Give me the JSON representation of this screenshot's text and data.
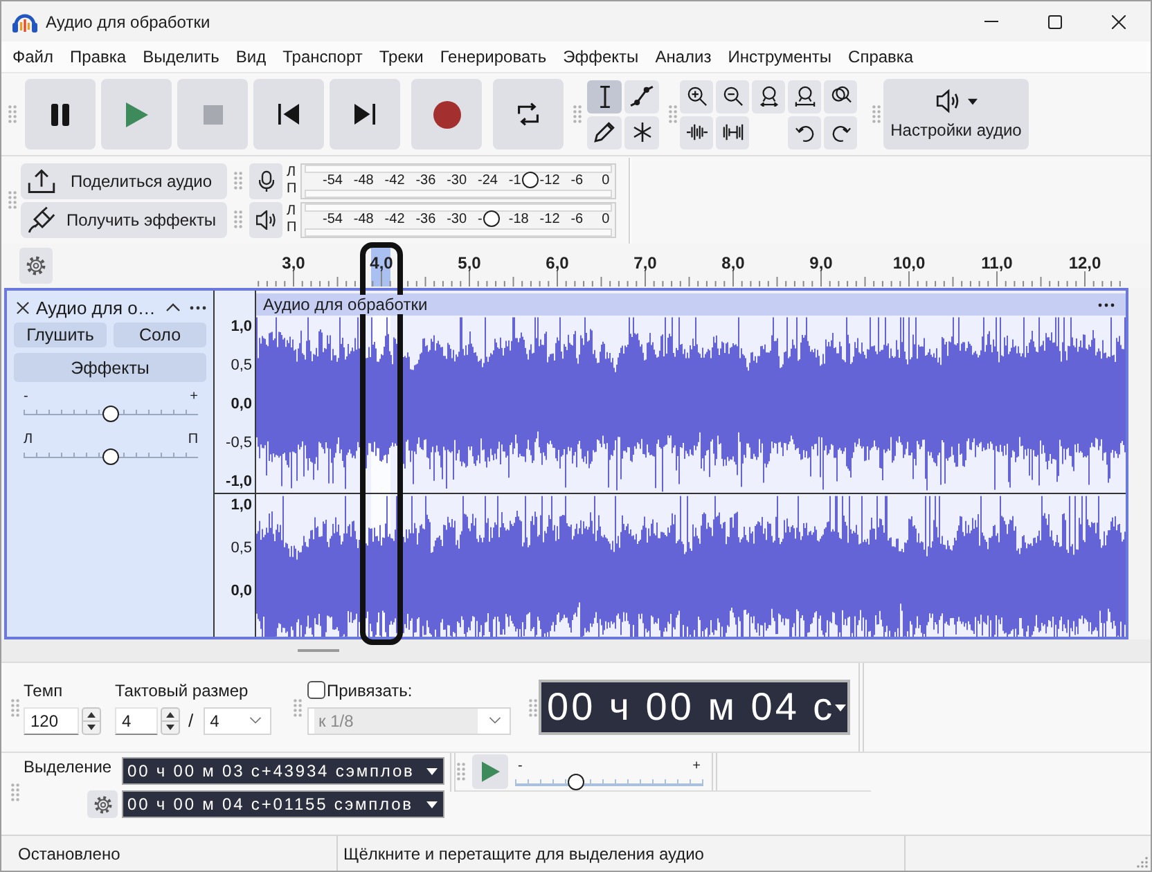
{
  "window": {
    "title": "Аудио для обработки"
  },
  "menu": [
    "Файл",
    "Правка",
    "Выделить",
    "Вид",
    "Транспорт",
    "Треки",
    "Генерировать",
    "Эффекты",
    "Анализ",
    "Инструменты",
    "Справка"
  ],
  "transport": [
    {
      "kind": "pause",
      "disabled": false
    },
    {
      "kind": "play",
      "disabled": false
    },
    {
      "kind": "stop",
      "disabled": true
    },
    {
      "kind": "skip_start",
      "disabled": false
    },
    {
      "kind": "skip_end",
      "disabled": false
    },
    {
      "kind": "record",
      "disabled": false
    },
    {
      "kind": "loop",
      "disabled": false
    }
  ],
  "tools": [
    {
      "kind": "select",
      "selected": true
    },
    {
      "kind": "envelope",
      "selected": false
    },
    {
      "kind": "draw",
      "selected": false
    },
    {
      "kind": "multi",
      "selected": false
    }
  ],
  "audio_setup": {
    "label": "Настройки аудио"
  },
  "share_audio": {
    "label": "Поделиться аудио"
  },
  "get_effects": {
    "label": "Получить эффекты"
  },
  "meters": [
    {
      "kind": "record",
      "channels": [
        "Л",
        "П"
      ],
      "ticks": [
        "-54",
        "-48",
        "-42",
        "-36",
        "-30",
        "-24",
        "-1",
        "-12",
        "-6",
        "0"
      ],
      "level": 0.73
    },
    {
      "kind": "playback",
      "channels": [
        "Л",
        "П"
      ],
      "ticks": [
        "-54",
        "-48",
        "-42",
        "-36",
        "-30",
        "-",
        "-18",
        "-12",
        "-6",
        "0"
      ],
      "level": 0.605
    }
  ],
  "ruler": {
    "ticks": [
      "3,0",
      "4,0",
      "5,0",
      "6,0",
      "7,0",
      "8,0",
      "9,0",
      "10,0",
      "11,0",
      "12,0"
    ]
  },
  "track": {
    "name": "Аудио для о…",
    "mute": "Глушить",
    "solo": "Соло",
    "effects": "Эффекты",
    "gain": {
      "min_label": "-",
      "max_label": "+",
      "level": 0.5
    },
    "pan": {
      "min_label": "Л",
      "max_label": "П",
      "level": 0.5
    },
    "clip_name": "Аудио для обработки",
    "channels": [
      {
        "scale": [
          "1,0",
          "0,5",
          "0,0",
          "-0,5",
          "-1,0"
        ]
      },
      {
        "scale": [
          "1,0",
          "0,5",
          "0,0"
        ]
      }
    ]
  },
  "time_signature": {
    "tempo_label": "Темп",
    "tempo": "120",
    "signature_label": "Тактовый размер",
    "beats": "4",
    "separator": "/",
    "note": "4"
  },
  "snap": {
    "label": "Привязать:",
    "checked": false,
    "value": "к 1/8",
    "disabled": true
  },
  "time_display": {
    "value": "00 ч 00 м 04 с"
  },
  "selection": {
    "label": "Выделение",
    "start": "00 ч 00 м 03 с+43934 сэмплов",
    "end": "00 ч 00 м 04 с+01155 сэмплов"
  },
  "play_at_speed": {
    "min_label": "-",
    "max_label": "+",
    "level": 0.32
  },
  "status_bar": [
    "Остановлено",
    "Щёлкните и перетащите для выделения аудио"
  ]
}
